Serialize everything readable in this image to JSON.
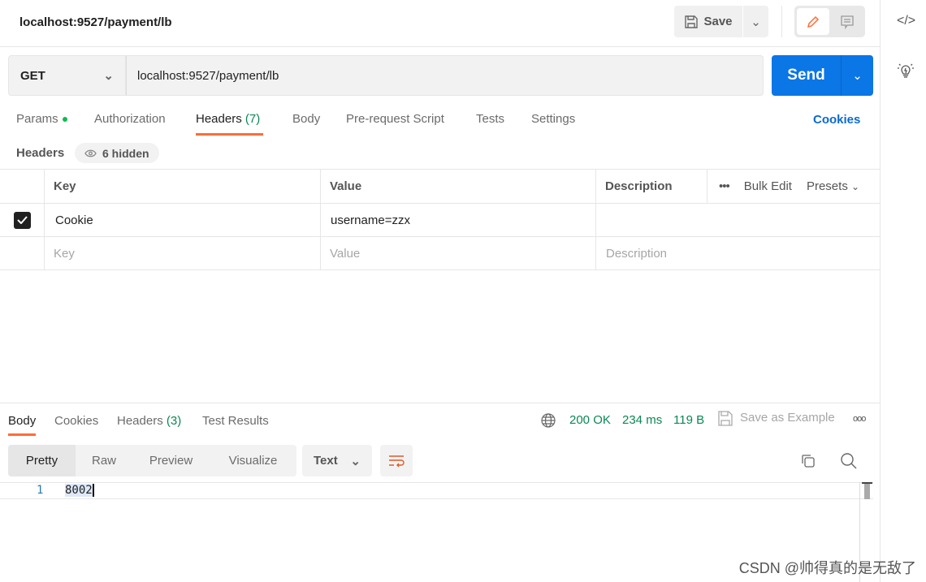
{
  "request": {
    "title": "localhost:9527/payment/lb",
    "save_label": "Save",
    "method": "GET",
    "url": "localhost:9527/payment/lb",
    "send_label": "Send"
  },
  "tabs": {
    "params": "Params",
    "authorization": "Authorization",
    "headers": "Headers",
    "headers_count": "(7)",
    "body": "Body",
    "prerequest": "Pre-request Script",
    "tests": "Tests",
    "settings": "Settings",
    "cookies": "Cookies"
  },
  "headers": {
    "label": "Headers",
    "hidden": "6 hidden",
    "columns": {
      "key": "Key",
      "value": "Value",
      "description": "Description"
    },
    "bulk_edit": "Bulk Edit",
    "presets": "Presets",
    "rows": [
      {
        "checked": true,
        "key": "Cookie",
        "value": "username=zzx",
        "description": ""
      }
    ],
    "placeholder": {
      "key": "Key",
      "value": "Value",
      "description": "Description"
    }
  },
  "response": {
    "tabs": {
      "body": "Body",
      "cookies": "Cookies",
      "headers": "Headers",
      "headers_count": "(3)",
      "test_results": "Test Results"
    },
    "status": "200 OK",
    "time": "234 ms",
    "size": "119 B",
    "save_example": "Save as Example",
    "views": [
      "Pretty",
      "Raw",
      "Preview",
      "Visualize"
    ],
    "format": "Text",
    "lines": [
      {
        "num": "1",
        "text": "8002"
      }
    ]
  },
  "watermark": "CSDN @帅得真的是无敌了",
  "colors": {
    "accent": "#ff6c37",
    "send": "#0b76e6",
    "status": "#0a8754"
  }
}
